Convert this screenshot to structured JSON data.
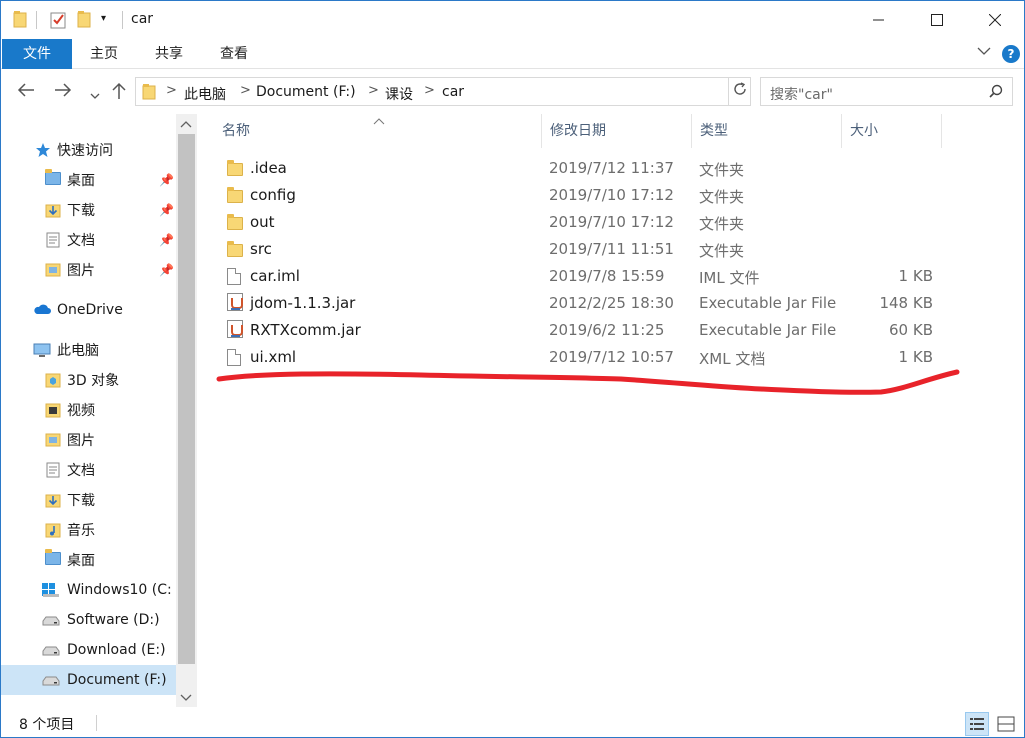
{
  "window": {
    "title": "car",
    "minimize_icon": "minimize-icon",
    "maximize_icon": "maximize-icon",
    "close_icon": "close-icon"
  },
  "ribbon": {
    "tabs": [
      {
        "label": "文件",
        "active": true
      },
      {
        "label": "主页"
      },
      {
        "label": "共享"
      },
      {
        "label": "查看"
      }
    ],
    "expand_icon": "chevron-down-icon",
    "help_label": "?"
  },
  "address": {
    "crumbs": [
      "此电脑",
      "Document (F:)",
      "课设",
      "car"
    ],
    "separator": ">"
  },
  "search": {
    "placeholder": "搜索\"car\""
  },
  "nav": {
    "quick_access": "快速访问",
    "pinned": [
      {
        "label": "桌面"
      },
      {
        "label": "下载"
      },
      {
        "label": "文档"
      },
      {
        "label": "图片"
      }
    ],
    "onedrive": "OneDrive",
    "this_pc": "此电脑",
    "pc_items": [
      {
        "label": "3D 对象"
      },
      {
        "label": "视频"
      },
      {
        "label": "图片"
      },
      {
        "label": "文档"
      },
      {
        "label": "下载"
      },
      {
        "label": "音乐"
      },
      {
        "label": "桌面"
      },
      {
        "label": "Windows10 (C:"
      },
      {
        "label": "Software (D:)"
      },
      {
        "label": "Download (E:)"
      },
      {
        "label": "Document (F:)",
        "selected": true
      }
    ]
  },
  "columns": {
    "name": "名称",
    "date": "修改日期",
    "type": "类型",
    "size": "大小"
  },
  "files": [
    {
      "name": ".idea",
      "date": "2019/7/12 11:37",
      "type": "文件夹",
      "size": "",
      "kind": "folder"
    },
    {
      "name": "config",
      "date": "2019/7/10 17:12",
      "type": "文件夹",
      "size": "",
      "kind": "folder"
    },
    {
      "name": "out",
      "date": "2019/7/10 17:12",
      "type": "文件夹",
      "size": "",
      "kind": "folder"
    },
    {
      "name": "src",
      "date": "2019/7/11 11:51",
      "type": "文件夹",
      "size": "",
      "kind": "folder"
    },
    {
      "name": "car.iml",
      "date": "2019/7/8 15:59",
      "type": "IML 文件",
      "size": "1 KB",
      "kind": "doc"
    },
    {
      "name": "jdom-1.1.3.jar",
      "date": "2012/2/25 18:30",
      "type": "Executable Jar File",
      "size": "148 KB",
      "kind": "jar"
    },
    {
      "name": "RXTXcomm.jar",
      "date": "2019/6/2 11:25",
      "type": "Executable Jar File",
      "size": "60 KB",
      "kind": "jar"
    },
    {
      "name": "ui.xml",
      "date": "2019/7/12 10:57",
      "type": "XML 文档",
      "size": "1 KB",
      "kind": "doc"
    }
  ],
  "status": {
    "item_count": "8 个项目"
  },
  "colors": {
    "accent": "#1979ca",
    "selection": "#cce4f7",
    "annotation": "#e8232a",
    "folder": "#f8d775"
  }
}
